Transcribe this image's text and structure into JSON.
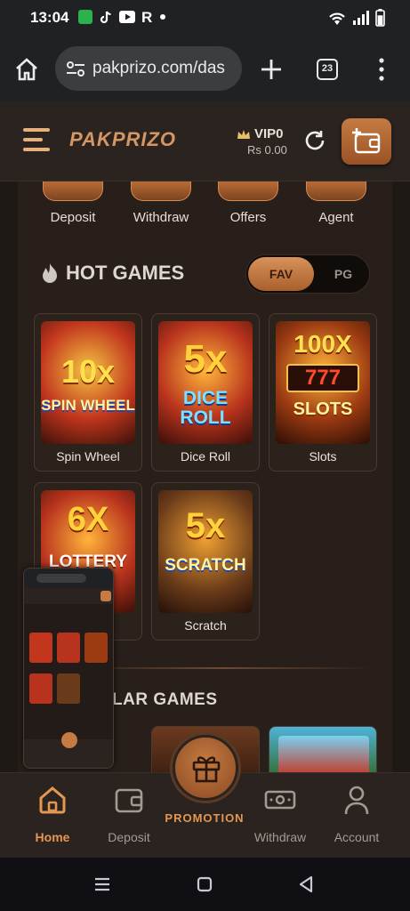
{
  "status": {
    "time": "13:04",
    "battery_level": 0.7
  },
  "browser": {
    "url": "pakprizo.com/das",
    "tab_count": "23"
  },
  "header": {
    "brand": "PAKPRIZO",
    "vip": "VIP0",
    "balance": "Rs 0.00"
  },
  "quick_actions": [
    {
      "label": "Deposit"
    },
    {
      "label": "Withdraw"
    },
    {
      "label": "Offers"
    },
    {
      "label": "Agent"
    }
  ],
  "hot_games": {
    "title": "HOT GAMES",
    "tabs": {
      "fav": "FAV",
      "pg": "PG",
      "selected": "FAV"
    },
    "games": [
      {
        "label": "Spin Wheel",
        "art_top": "10x",
        "art_bottom": "SPIN WHEEL"
      },
      {
        "label": "Dice Roll",
        "art_top": "5x",
        "art_bottom": "DICE ROLL"
      },
      {
        "label": "Slots",
        "art_top": "100X",
        "art_bottom": "SLOTS"
      },
      {
        "label": "Lottery",
        "art_top": "6X",
        "art_bottom": "LOTTERY"
      },
      {
        "label": "Scratch",
        "art_top": "5x",
        "art_bottom": "SCRATCH"
      }
    ]
  },
  "popular": {
    "title_visible": "LAR GAMES"
  },
  "bottom_nav": {
    "home": "Home",
    "deposit": "Deposit",
    "promotion": "PROMOTION",
    "withdraw": "Withdraw",
    "account": "Account",
    "active": "Home"
  },
  "colors": {
    "accent": "#e5964f",
    "header_bg": "#2a2320",
    "main_bg": "#281f1a"
  }
}
